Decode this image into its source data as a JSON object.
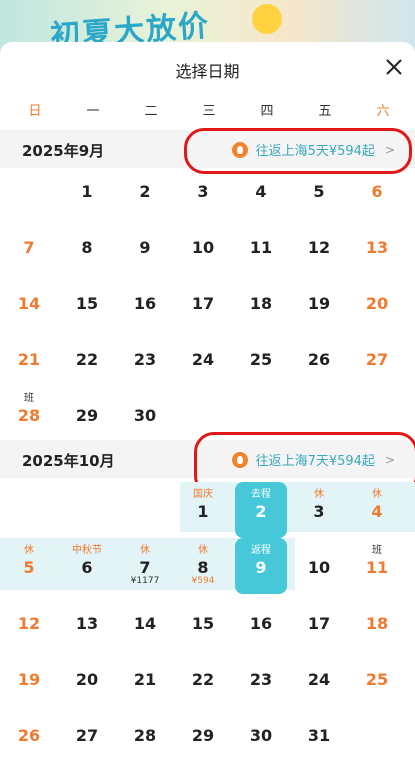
{
  "banner": {
    "text": "初夏大放价"
  },
  "header": {
    "title": "选择日期"
  },
  "weekdays": [
    "日",
    "一",
    "二",
    "三",
    "四",
    "五",
    "六"
  ],
  "months": [
    {
      "title": "2025年9月",
      "promo": "往返上海5天¥594起",
      "days": [
        "1",
        "2",
        "3",
        "4",
        "5",
        "6",
        "7",
        "8",
        "9",
        "10",
        "11",
        "12",
        "13",
        "14",
        "15",
        "16",
        "17",
        "18",
        "19",
        "20",
        "21",
        "22",
        "23",
        "24",
        "25",
        "26",
        "27",
        "28",
        "29",
        "30"
      ],
      "tags": {
        "28": "班"
      }
    },
    {
      "title": "2025年10月",
      "promo": "往返上海7天¥594起",
      "days": [
        "1",
        "2",
        "3",
        "4",
        "5",
        "6",
        "7",
        "8",
        "9",
        "10",
        "11",
        "12",
        "13",
        "14",
        "15",
        "16",
        "17",
        "18",
        "19",
        "20",
        "21",
        "22",
        "23",
        "24",
        "25",
        "26",
        "27",
        "28",
        "29",
        "30",
        "31"
      ],
      "tags": {
        "1": "国庆",
        "2": "去程",
        "3": "休",
        "4": "休",
        "5": "休",
        "6": "中秋节",
        "7": "休",
        "8": "休",
        "9": "返程",
        "11": "班"
      },
      "prices": {
        "7": "¥1177",
        "8": "¥594"
      }
    }
  ],
  "colors": {
    "accent": "#46c8d9",
    "weekend": "#f07a2e",
    "annotation": "#e01818"
  }
}
